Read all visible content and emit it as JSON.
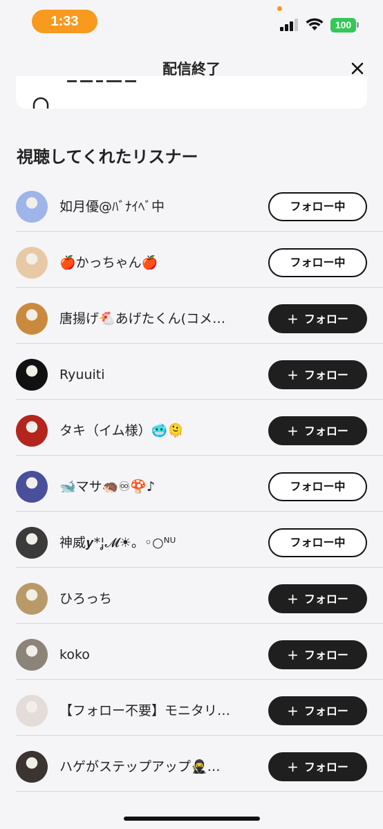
{
  "status_bar": {
    "time": "1:33",
    "battery": "100",
    "icons": [
      "cellular-signal-icon",
      "wifi-icon",
      "battery-icon"
    ]
  },
  "header": {
    "title": "配信終了",
    "close_icon": "close-icon"
  },
  "section": {
    "title": "視聴してくれたリスナー"
  },
  "follow_labels": {
    "following": "フォロー中",
    "follow": "フォロー",
    "follow_icon": "plus-icon"
  },
  "listeners": [
    {
      "name": "如月優@ﾊﾞﾅｲﾍﾞ中",
      "following": true,
      "avatar_color": "#9fb4e8"
    },
    {
      "name": "🍎かっちゃん🍎",
      "following": true,
      "avatar_color": "#e8c9a6"
    },
    {
      "name": "唐揚げ🐔あげたくん(コメ…",
      "following": false,
      "avatar_color": "#c98a3e"
    },
    {
      "name": "Ryuuiti",
      "following": false,
      "avatar_color": "#111111"
    },
    {
      "name": "タキ（イム様）🥶🫠",
      "following": false,
      "avatar_color": "#b3261e"
    },
    {
      "name": "🐋マサ🦔♾🍄♪",
      "following": true,
      "avatar_color": "#4a4f9c"
    },
    {
      "name": "神威𝒚*¦̥𝓜☀︎。◦○ᴺᵁ",
      "following": true,
      "avatar_color": "#3b3b3b"
    },
    {
      "name": "ひろっち",
      "following": false,
      "avatar_color": "#b89a6a"
    },
    {
      "name": "koko",
      "following": false,
      "avatar_color": "#8c8478"
    },
    {
      "name": "【フォロー不要】モニタリ…",
      "following": false,
      "avatar_color": "#e4dcd8"
    },
    {
      "name": "ハゲがステップアップ🥷…",
      "following": false,
      "avatar_color": "#3c3430"
    }
  ]
}
